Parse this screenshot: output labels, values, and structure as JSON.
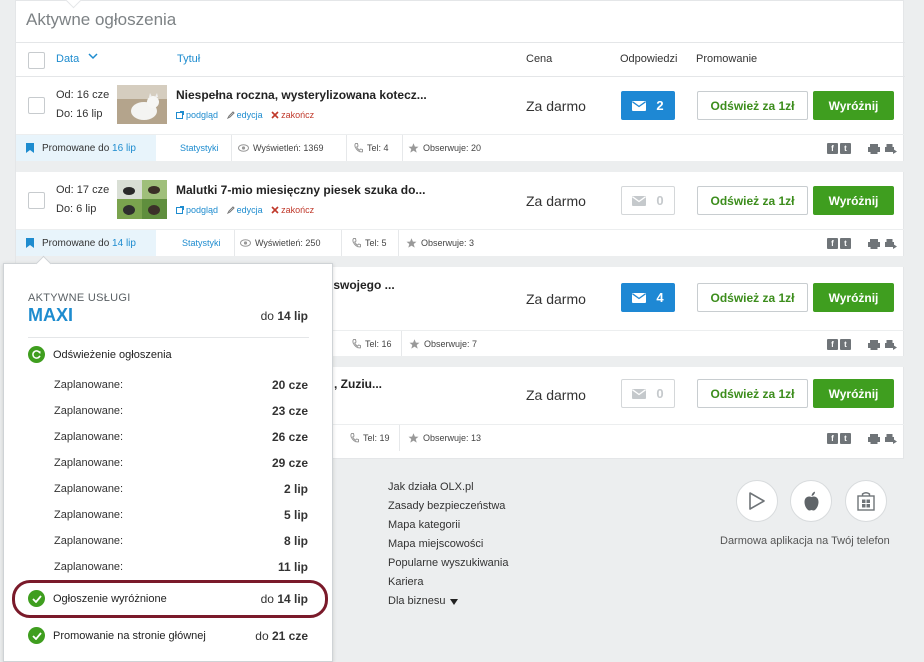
{
  "page_title": "Aktywne ogłoszenia",
  "table_header": {
    "date": "Data",
    "title": "Tytuł",
    "price": "Cena",
    "replies": "Odpowiedzi",
    "promotion": "Promowanie"
  },
  "listings": [
    {
      "date_from": "Od: 16 cze",
      "date_to": "Do: 16 lip",
      "title": "Niespełna roczna, wysterylizowana kotecz...",
      "preview": "podgląd",
      "edit": "edycja",
      "end": "zakończ",
      "price": "Za darmo",
      "replies": "2",
      "replies_active": true,
      "refresh_label": "Odśwież za 1zł",
      "feature_label": "Wyróżnij",
      "promo_label": "Promowane do",
      "promo_date": "16 lip",
      "stats_link": "Statystyki",
      "views": "Wyświetleń: 1369",
      "phone": "Tel: 4",
      "watch": "Obserwuje: 20"
    },
    {
      "date_from": "Od: 17 cze",
      "date_to": "Do: 6 lip",
      "title": "Malutki 7-mio miesięczny piesek szuka do...",
      "preview": "podgląd",
      "edit": "edycja",
      "end": "zakończ",
      "price": "Za darmo",
      "replies": "0",
      "replies_active": false,
      "refresh_label": "Odśwież za 1zł",
      "feature_label": "Wyróżnij",
      "promo_label": "Promowane do",
      "promo_date": "14 lip",
      "stats_link": "Statystyki",
      "views": "Wyświetleń: 250",
      "phone": "Tel: 5",
      "watch": "Obserwuje: 3"
    },
    {
      "title_tail": "na swojego ...",
      "price": "Za darmo",
      "replies": "4",
      "replies_active": true,
      "refresh_label": "Odśwież za 1zł",
      "feature_label": "Wyróżnij",
      "phone": "Tel: 16",
      "watch": "Obserwuje: 7"
    },
    {
      "title_tail": ", Zuziu...",
      "price": "Za darmo",
      "replies": "0",
      "replies_active": false,
      "refresh_label": "Odśwież za 1zł",
      "feature_label": "Wyróżnij",
      "phone": "Tel: 19",
      "watch": "Obserwuje: 13"
    }
  ],
  "social": {
    "facebook": "f",
    "twitter": "t"
  },
  "popup": {
    "kicker": "AKTYWNE USŁUGI",
    "package": "MAXI",
    "until_prefix": "do",
    "until_date": "14 lip",
    "refresh_service": "Odświeżenie ogłoszenia",
    "scheduled": [
      {
        "label": "Zaplanowane:",
        "date": "20 cze"
      },
      {
        "label": "Zaplanowane:",
        "date": "23 cze"
      },
      {
        "label": "Zaplanowane:",
        "date": "26 cze"
      },
      {
        "label": "Zaplanowane:",
        "date": "29 cze"
      },
      {
        "label": "Zaplanowane:",
        "date": "2 lip"
      },
      {
        "label": "Zaplanowane:",
        "date": "5 lip"
      },
      {
        "label": "Zaplanowane:",
        "date": "8 lip"
      },
      {
        "label": "Zaplanowane:",
        "date": "11 lip"
      }
    ],
    "featured_service": "Ogłoszenie wyróżnione",
    "featured_prefix": "do",
    "featured_date": "14 lip",
    "homepage_service": "Promowanie na stronie głównej",
    "homepage_prefix": "do",
    "homepage_date": "21 cze"
  },
  "footer": {
    "links": [
      "Jak działa OLX.pl",
      "Zasady bezpieczeństwa",
      "Mapa kategorii",
      "Mapa miejscowości",
      "Popularne wyszukiwania",
      "Kariera",
      "Dla biznesu"
    ],
    "app_tagline": "Darmowa aplikacja na Twój telefon",
    "store_icons": [
      "google-play-icon",
      "apple-icon",
      "windows-store-icon"
    ]
  },
  "colors": {
    "link": "#1e8ccf",
    "feature_button": "#3f9e1f",
    "refresh_text": "#3c8d1c",
    "replies_active": "#1e88d4",
    "highlight_ring": "#7a1a2a",
    "end_link": "#c0392b"
  }
}
